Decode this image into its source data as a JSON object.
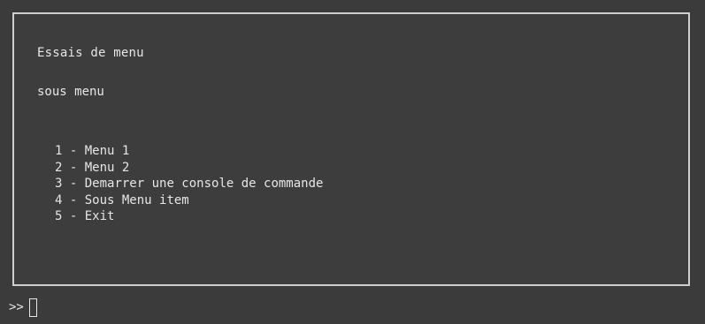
{
  "screen": {
    "title": "Essais de menu",
    "subtitle": "sous menu",
    "menu_items": [
      {
        "number": "1",
        "label": "Menu 1"
      },
      {
        "number": "2",
        "label": "Menu 2"
      },
      {
        "number": "3",
        "label": "Demarrer une console de commande"
      },
      {
        "number": "4",
        "label": "Sous Menu item"
      },
      {
        "number": "5",
        "label": "Exit"
      }
    ]
  },
  "prompt": {
    "symbol": ">>"
  },
  "colors": {
    "background": "#3b3b3b",
    "text": "#e6e6e6",
    "border": "#cfcfcf"
  }
}
